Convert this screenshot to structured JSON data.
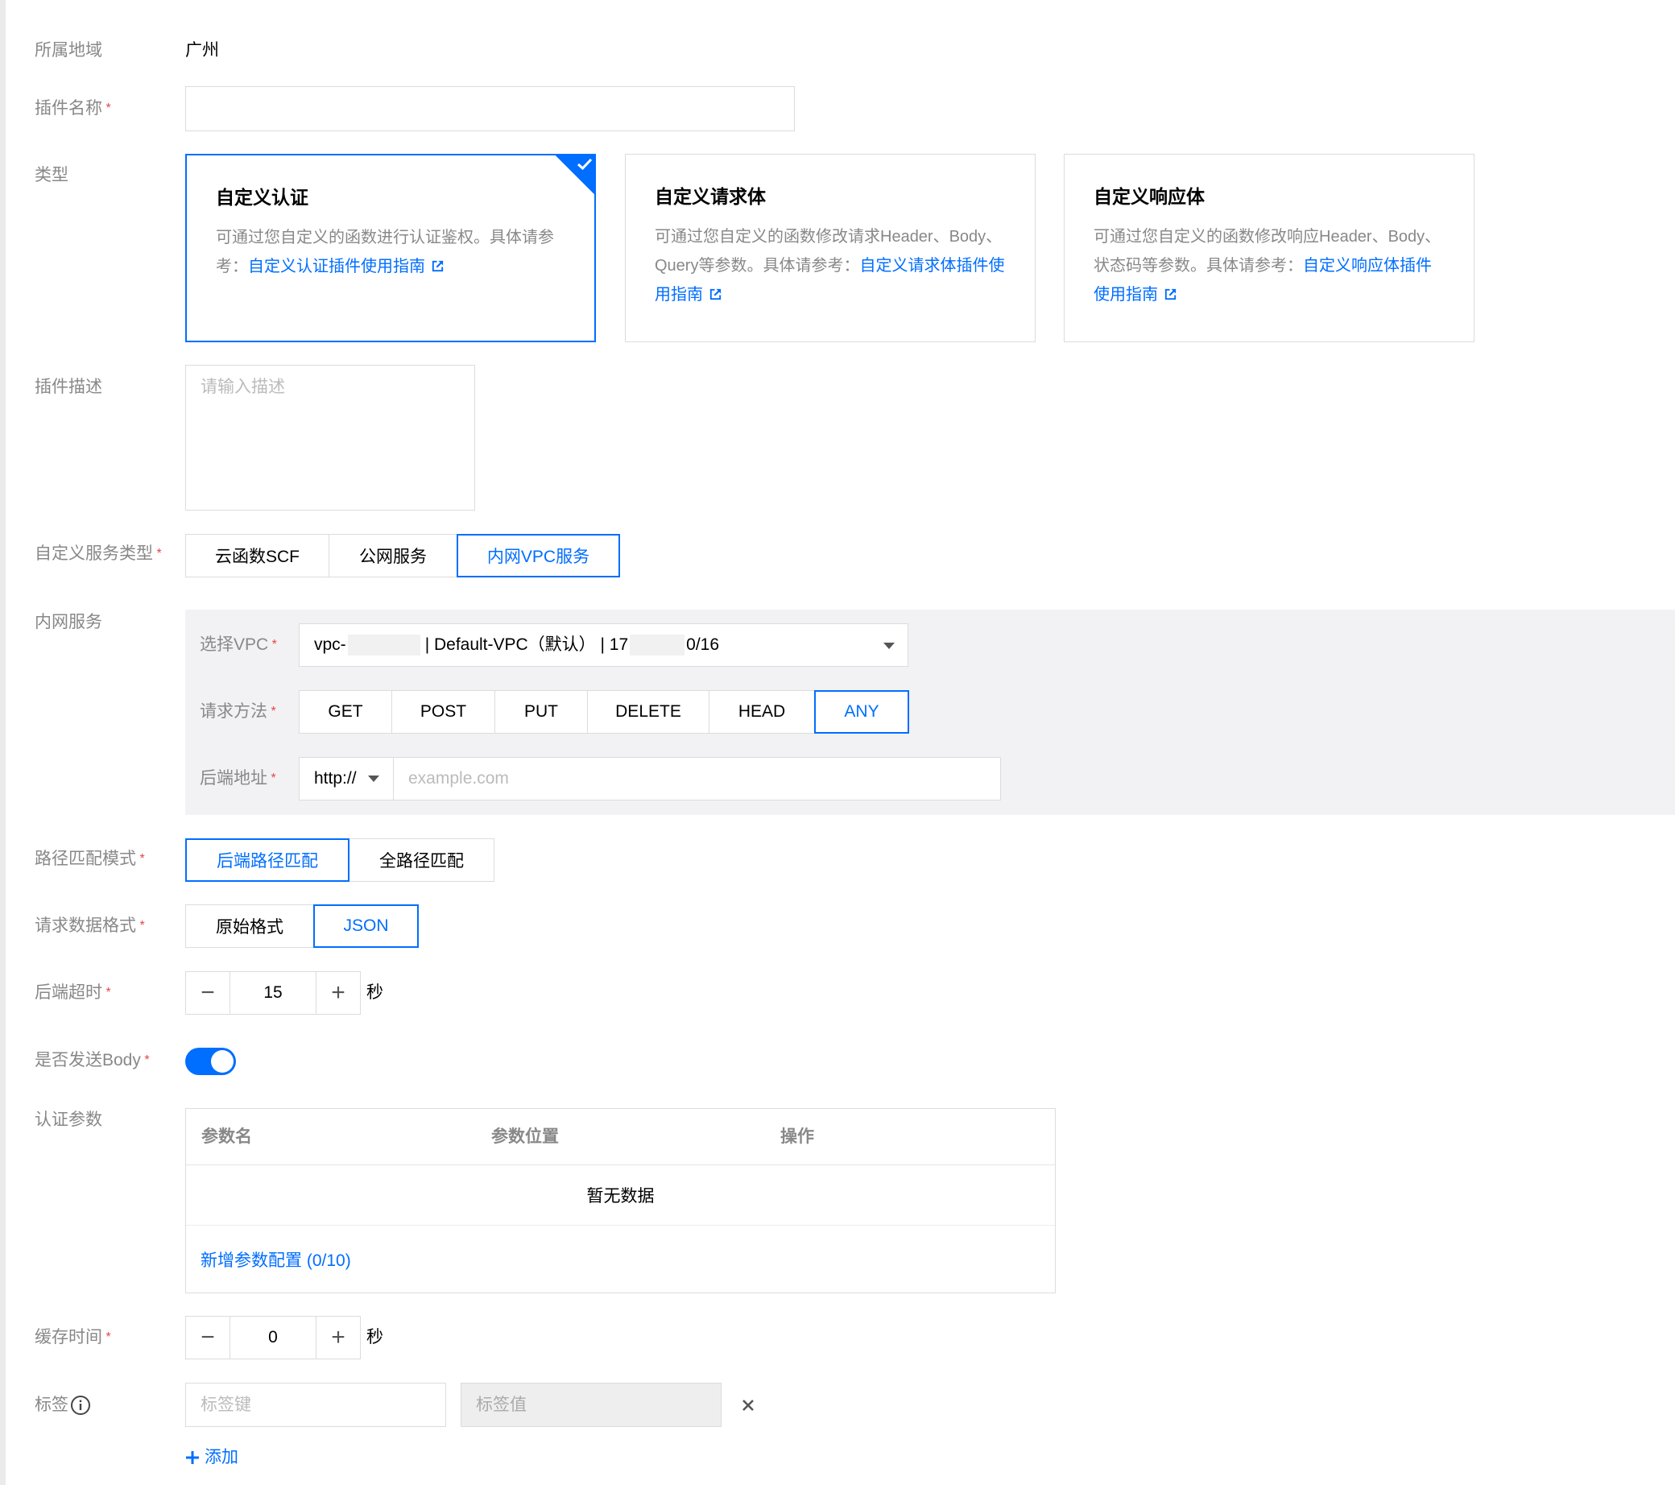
{
  "region": {
    "label": "所属地域",
    "value": "广州"
  },
  "plugin_name": {
    "label": "插件名称",
    "value": "",
    "placeholder": ""
  },
  "type": {
    "label": "类型",
    "cards": [
      {
        "title": "自定义认证",
        "desc": "可通过您自定义的函数进行认证鉴权。具体请参考：",
        "link": "自定义认证插件使用指南",
        "selected": true
      },
      {
        "title": "自定义请求体",
        "desc": "可通过您自定义的函数修改请求Header、Body、Query等参数。具体请参考：",
        "link": "自定义请求体插件使用指南",
        "selected": false
      },
      {
        "title": "自定义响应体",
        "desc": "可通过您自定义的函数修改响应Header、Body、状态码等参数。具体请参考：",
        "link": "自定义响应体插件使用指南",
        "selected": false
      }
    ]
  },
  "plugin_desc": {
    "label": "插件描述",
    "placeholder": "请输入描述"
  },
  "service_type": {
    "label": "自定义服务类型",
    "options": [
      "云函数SCF",
      "公网服务",
      "内网VPC服务"
    ],
    "selected": "内网VPC服务"
  },
  "vpc_service": {
    "label": "内网服务",
    "vpc": {
      "label": "选择VPC",
      "value_prefix": "vpc-",
      "value_mid": "| Default-VPC（默认） | 17",
      "value_suffix": "0/16"
    },
    "method": {
      "label": "请求方法",
      "options": [
        "GET",
        "POST",
        "PUT",
        "DELETE",
        "HEAD",
        "ANY"
      ],
      "selected": "ANY"
    },
    "backend": {
      "label": "后端地址",
      "protocol": "http://",
      "placeholder": "example.com"
    }
  },
  "path_match": {
    "label": "路径匹配模式",
    "options": [
      "后端路径匹配",
      "全路径匹配"
    ],
    "selected": "后端路径匹配"
  },
  "data_format": {
    "label": "请求数据格式",
    "options": [
      "原始格式",
      "JSON"
    ],
    "selected": "JSON"
  },
  "timeout": {
    "label": "后端超时",
    "value": "15",
    "unit": "秒"
  },
  "send_body": {
    "label": "是否发送Body",
    "on": true
  },
  "auth_params": {
    "label": "认证参数",
    "columns": [
      "参数名",
      "参数位置",
      "操作"
    ],
    "empty_text": "暂无数据",
    "add_text": "新增参数配置 (0/10)"
  },
  "cache_time": {
    "label": "缓存时间",
    "value": "0",
    "unit": "秒"
  },
  "tags": {
    "label": "标签",
    "key_placeholder": "标签键",
    "value_placeholder": "标签值",
    "add_text": "添加"
  },
  "colors": {
    "primary": "#006eff",
    "required": "#e54545",
    "label": "#888888"
  }
}
